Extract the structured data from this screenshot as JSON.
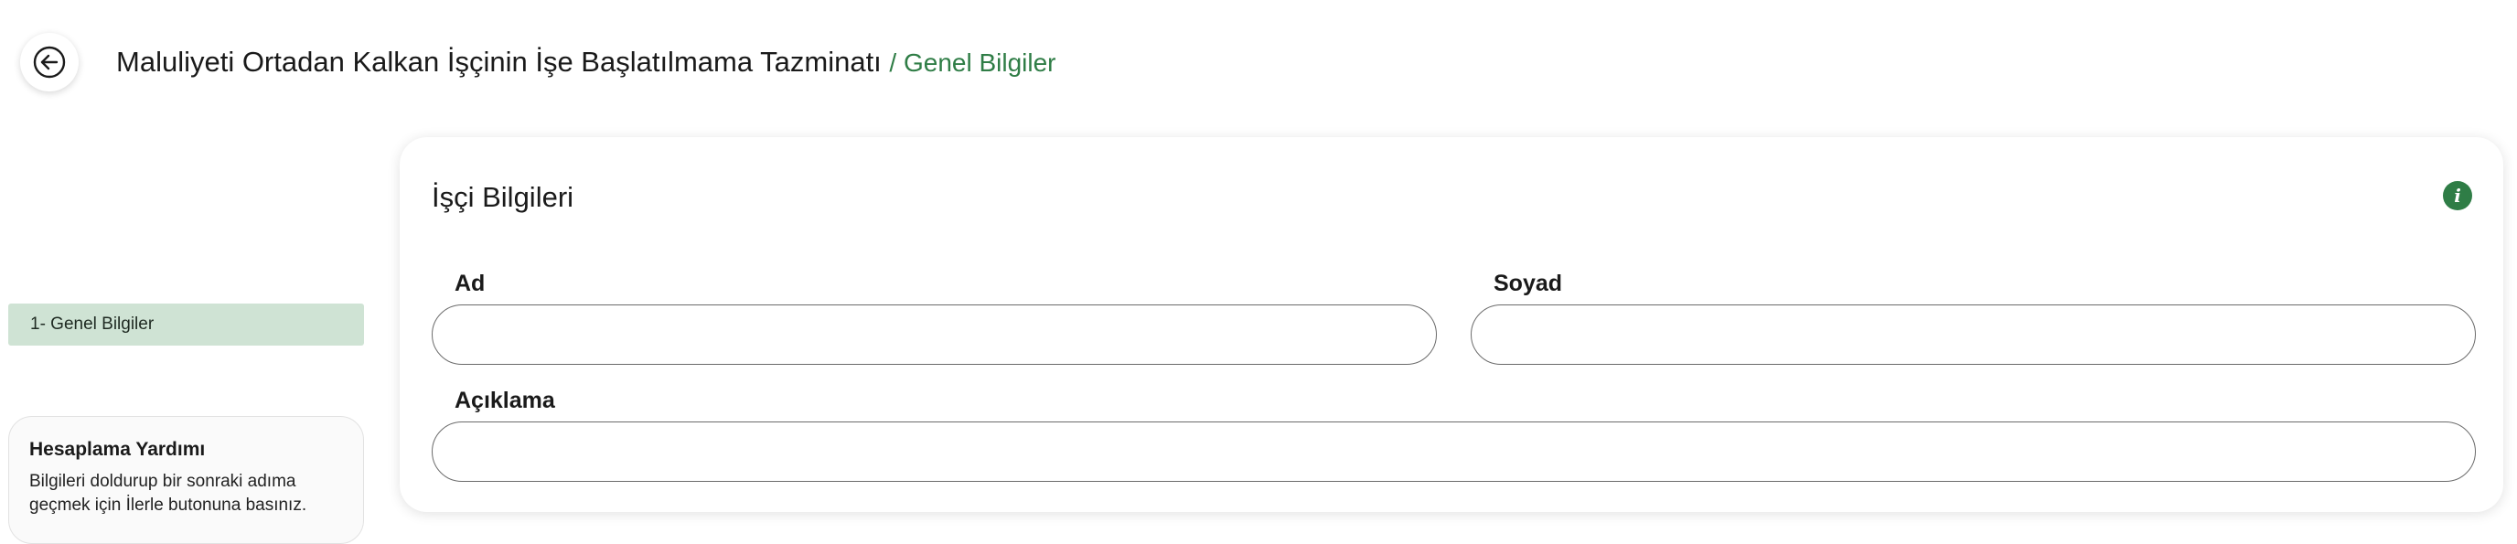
{
  "header": {
    "title": "Maluliyeti Ortadan Kalkan İşçinin İşe Başlatılmama Tazminatı",
    "crumb": "/ Genel Bilgiler"
  },
  "steps": {
    "items": [
      {
        "label": "1- Genel Bilgiler",
        "active": true
      }
    ]
  },
  "help": {
    "title": "Hesaplama Yardımı",
    "text": "Bilgileri doldurup bir sonraki adıma geçmek için İlerle butonuna basınız."
  },
  "form": {
    "section_title": "İşçi Bilgileri",
    "fields": {
      "first_name": {
        "label": "Ad",
        "value": "",
        "placeholder": ""
      },
      "last_name": {
        "label": "Soyad",
        "value": "",
        "placeholder": ""
      },
      "description": {
        "label": "Açıklama",
        "value": "",
        "placeholder": ""
      }
    }
  },
  "icons": {
    "back": "arrow-left-circle-icon",
    "info": "info-icon"
  },
  "colors": {
    "accent": "#2f7d46",
    "active_step_bg": "#cfe3d4",
    "input_border": "#6b6b6b"
  }
}
